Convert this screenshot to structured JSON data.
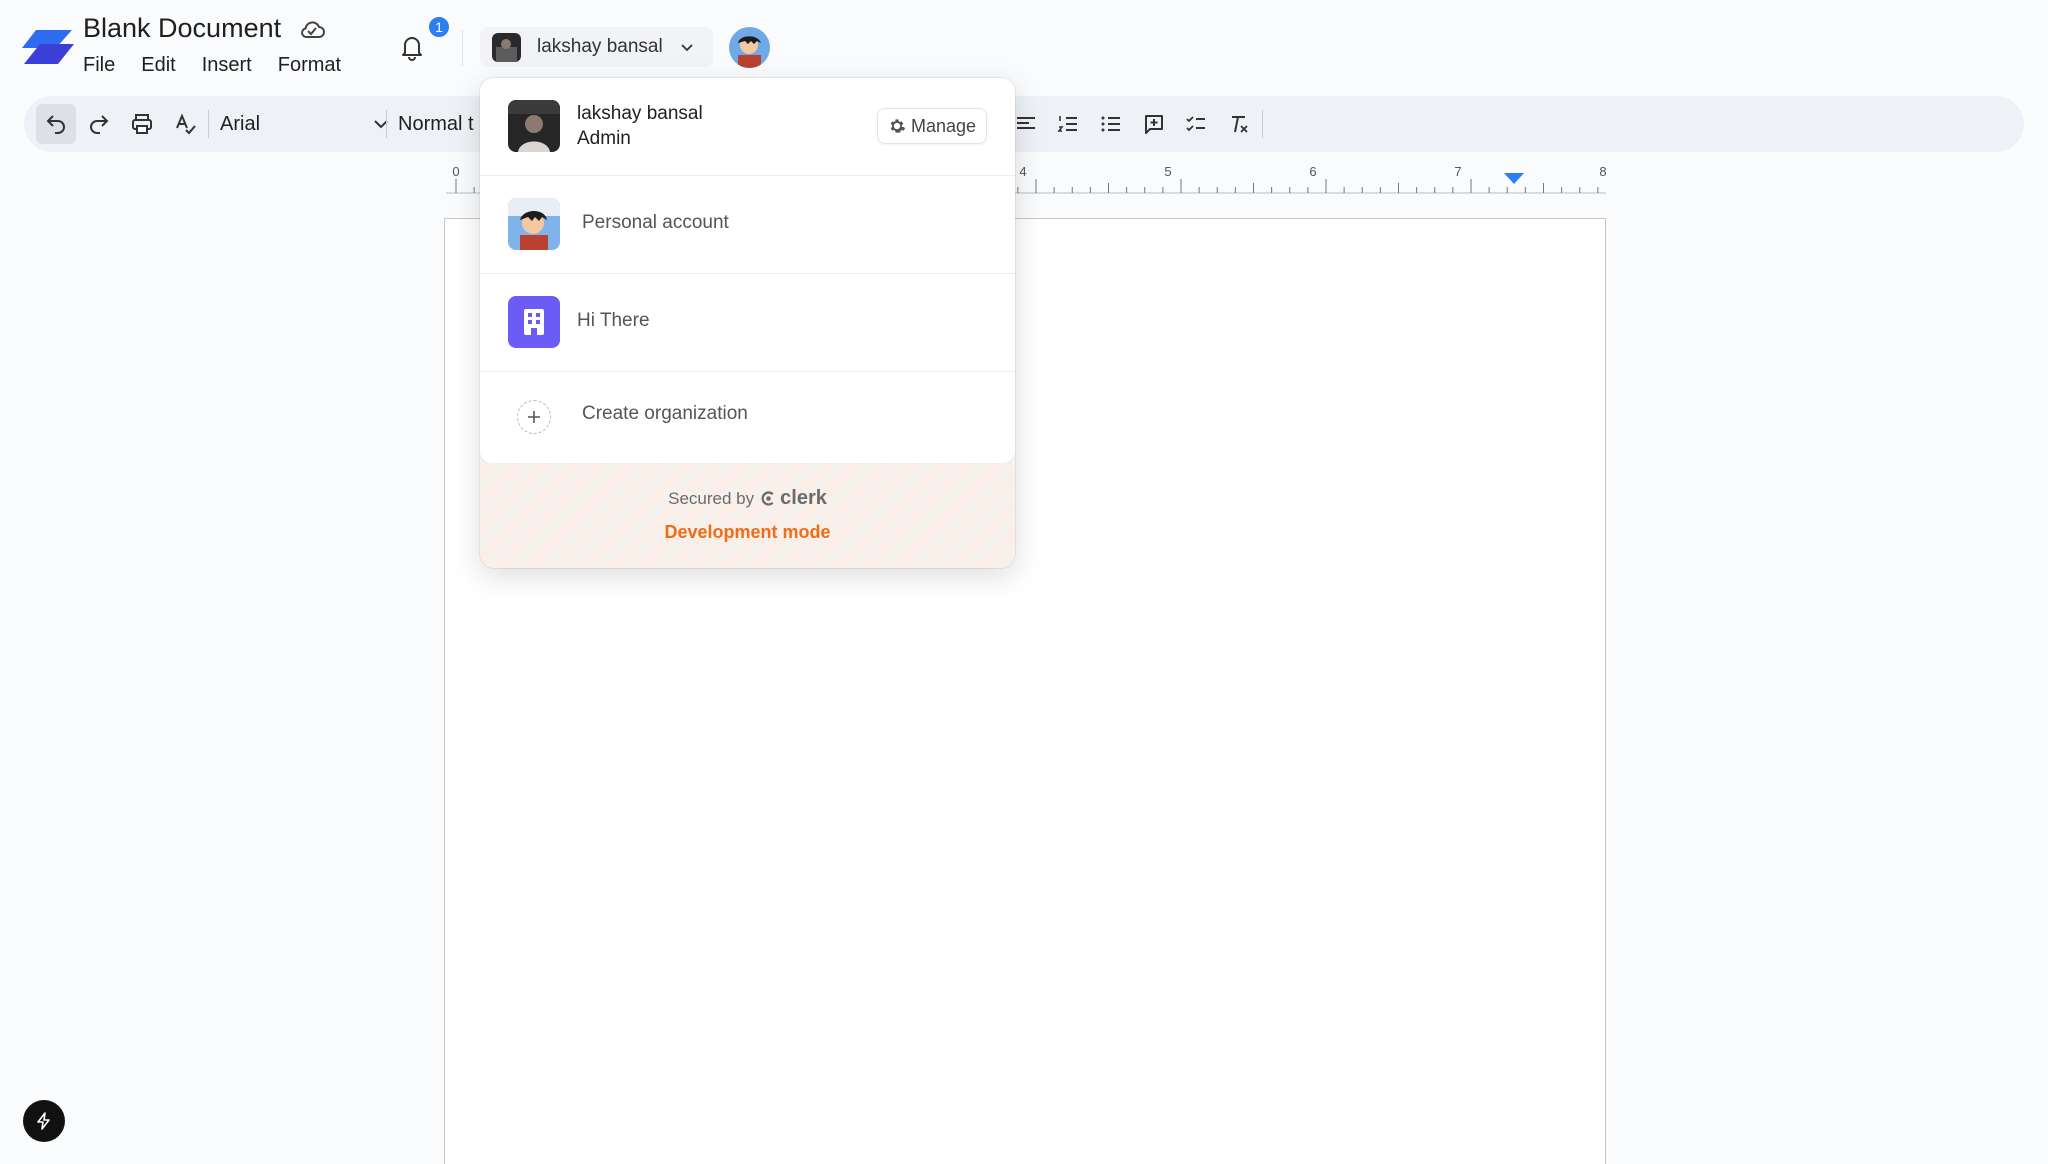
{
  "header": {
    "title": "Blank Document",
    "menus": [
      "File",
      "Edit",
      "Insert",
      "Format"
    ],
    "notification_count": "1",
    "org_switcher_name": "lakshay bansal"
  },
  "toolbar": {
    "font_family_value": "Arial",
    "text_style_value": "Normal t"
  },
  "ruler": {
    "labels": [
      "0",
      "4",
      "5",
      "6",
      "7",
      "8"
    ]
  },
  "org_menu": {
    "active": {
      "name": "lakshay bansal",
      "role": "Admin",
      "manage_label": "Manage"
    },
    "personal_label": "Personal account",
    "org_label": "Hi There",
    "create_label": "Create organization",
    "secured_by": "Secured by",
    "brand": "clerk",
    "dev_mode": "Development mode"
  },
  "colors": {
    "accent": "#2b7ff0",
    "org_purple": "#6b5cf5",
    "dev_orange": "#f36b16"
  },
  "icons": {
    "logo": "app-logo-icon",
    "cloud": "cloud-icon",
    "bell": "bell-icon",
    "undo": "undo-icon",
    "redo": "redo-icon",
    "print": "print-icon",
    "spellcheck": "spellcheck-icon",
    "align": "align-left-icon",
    "numbered_list": "numbered-list-icon",
    "bullet_list": "bullet-list-icon",
    "comment": "add-comment-icon",
    "checklist": "checklist-icon",
    "clear_format": "clear-formatting-icon"
  }
}
